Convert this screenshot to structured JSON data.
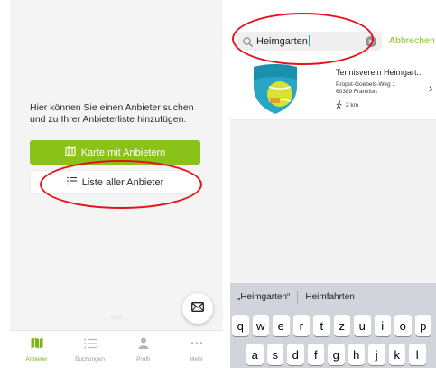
{
  "left_screen": {
    "intro_text": "Hier können Sie einen Anbieter suchen und zu Ihrer Anbieterliste hinzufügen.",
    "map_button_label": "Karte mit Anbietern",
    "list_button_label": "Liste aller Anbieter",
    "tabs": [
      {
        "label": "Anbieter",
        "icon": "map-icon",
        "active": true
      },
      {
        "label": "Buchungen",
        "icon": "list-icon",
        "active": false
      },
      {
        "label": "Profil",
        "icon": "person-icon",
        "active": false
      },
      {
        "label": "Mehr",
        "icon": "more-icon",
        "active": false
      }
    ]
  },
  "right_screen": {
    "search_value": "Heimgarten",
    "cancel_label": "Abbrechen",
    "result": {
      "name": "Tennisverein Heimgart...",
      "street": "Propst-Goebels-Weg 1",
      "city": "60389 Frankfurt",
      "distance": "2 km"
    },
    "keyboard": {
      "suggestions": [
        "„Heimgarten“",
        "Heimfahrten"
      ],
      "row1": [
        "q",
        "w",
        "e",
        "r",
        "t",
        "z",
        "u",
        "i",
        "o",
        "p"
      ],
      "row2": [
        "a",
        "s",
        "d",
        "f",
        "g",
        "h",
        "j",
        "k",
        "l"
      ]
    }
  },
  "colors": {
    "accent": "#8ac21a",
    "annotation": "#e5121a"
  }
}
